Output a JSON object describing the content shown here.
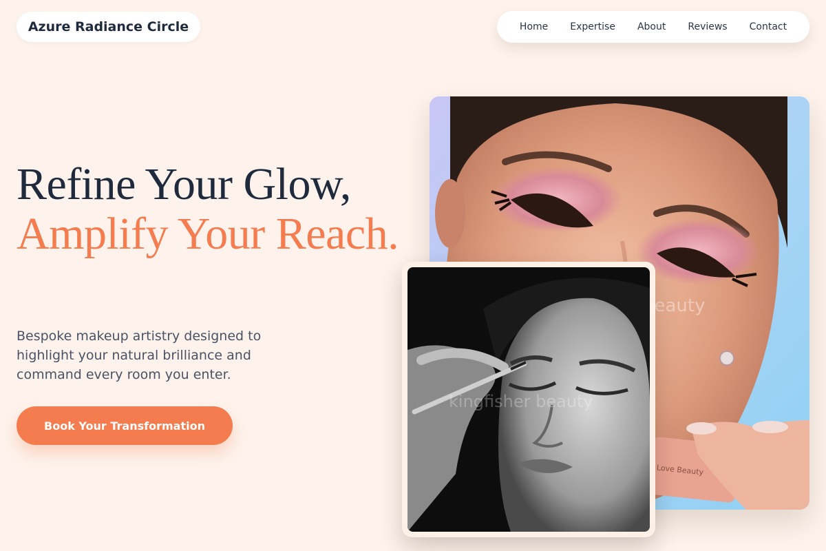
{
  "header": {
    "brand": "Azure Radiance Circle",
    "nav": [
      "Home",
      "Expertise",
      "About",
      "Reviews",
      "Contact"
    ]
  },
  "hero": {
    "title_line1": "Refine Your Glow,",
    "title_accent": "Amplify Your Reach.",
    "subtitle": "Bespoke makeup artistry designed to highlight your natural brilliance and command every room you enter.",
    "cta_label": "Book Your Transformation"
  },
  "images": {
    "main_alt": "Close-up of a woman with pink shimmer eyeshadow and winged eyeliner",
    "main_watermark": "beauty",
    "product_label": "Love Beauty",
    "inset_alt": "Black and white photo of makeup artist applying eyeliner",
    "inset_watermark": "kingfisher beauty"
  },
  "colors": {
    "background": "#fdf3ec",
    "accent": "#f47c4e",
    "heading": "#1f2a3c",
    "body_text": "#4a5263"
  }
}
